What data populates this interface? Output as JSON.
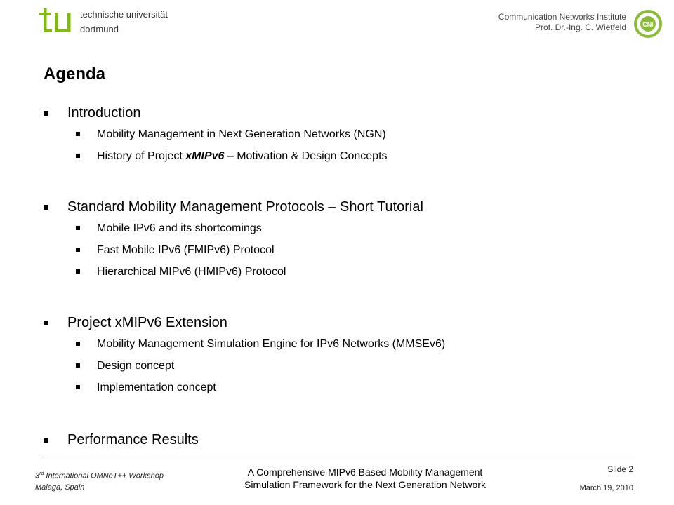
{
  "header": {
    "university_line1": "technische universität",
    "university_line2": "dortmund",
    "institute_line1": "Communication Networks Institute",
    "institute_line2": "Prof. Dr.-Ing. C. Wietfeld",
    "cni_logo_text": "CNI"
  },
  "slide_title": "Agenda",
  "agenda": [
    {
      "label": "Introduction",
      "subitems": [
        "Mobility Management in Next Generation Networks (NGN)",
        {
          "prefix": "History of Project ",
          "emphasis": "xMIPv6",
          "suffix": " – Motivation & Design Concepts"
        }
      ]
    },
    {
      "label": "Standard Mobility Management Protocols – Short Tutorial",
      "subitems": [
        "Mobile IPv6 and its shortcomings",
        "Fast Mobile IPv6 (FMIPv6) Protocol",
        "Hierarchical MIPv6 (HMIPv6) Protocol"
      ]
    },
    {
      "label": "Project xMIPv6 Extension",
      "subitems": [
        "Mobility Management  Simulation Engine for IPv6 Networks (MMSEv6)",
        "Design concept",
        "Implementation concept"
      ]
    },
    {
      "label": "Performance Results",
      "subitems": []
    }
  ],
  "footer": {
    "workshop_ordinal": "3",
    "workshop_sup": "rd",
    "workshop_name": " International OMNeT++ Workshop",
    "location": "Malaga, Spain",
    "paper_line1": "A Comprehensive MIPv6 Based Mobility Management",
    "paper_line2": "Simulation Framework for the Next Generation Network",
    "slide_number": "Slide 2",
    "date": "March 19, 2010"
  },
  "colors": {
    "tu_green": "#83b818",
    "cni_green": "#8cbb3c"
  }
}
